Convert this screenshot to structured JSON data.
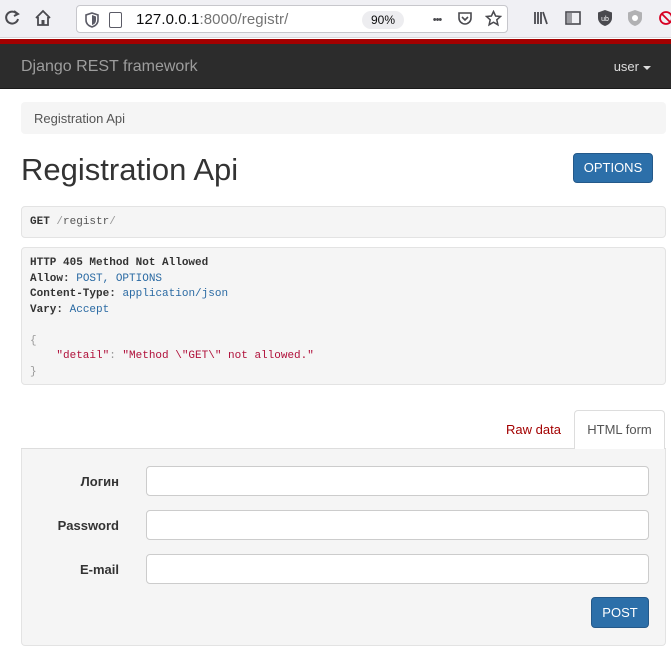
{
  "browser": {
    "url_host": "127.0.0.1",
    "url_rest": ":8000/registr/",
    "zoom": "90%",
    "more_glyph": "•••"
  },
  "navbar": {
    "brand": "Django REST framework",
    "user_menu": "user"
  },
  "breadcrumb": {
    "item": "Registration Api"
  },
  "page": {
    "title": "Registration Api",
    "options_label": "OPTIONS"
  },
  "request": {
    "method": "GET",
    "path": "registr"
  },
  "response": {
    "status_line": "HTTP 405 Method Not Allowed",
    "allow_key": "Allow:",
    "allow_value": "POST, OPTIONS",
    "content_type_key": "Content-Type:",
    "content_type_value": "application/json",
    "vary_key": "Vary:",
    "vary_value": "Accept",
    "brace_open": "{",
    "detail_key": "\"detail\"",
    "detail_value": "\"Method \\\"GET\\\" not allowed.\"",
    "brace_close": "}"
  },
  "tabs": {
    "raw": "Raw data",
    "html": "HTML form"
  },
  "form": {
    "login_label": "Логин",
    "password_label": "Password",
    "email_label": "E-mail",
    "login_value": "",
    "password_value": "",
    "email_value": "",
    "post_label": "POST"
  },
  "colors": {
    "accent_red": "#a30000",
    "button_blue": "#2c6fa9",
    "navbar": "#2c2c2c"
  }
}
